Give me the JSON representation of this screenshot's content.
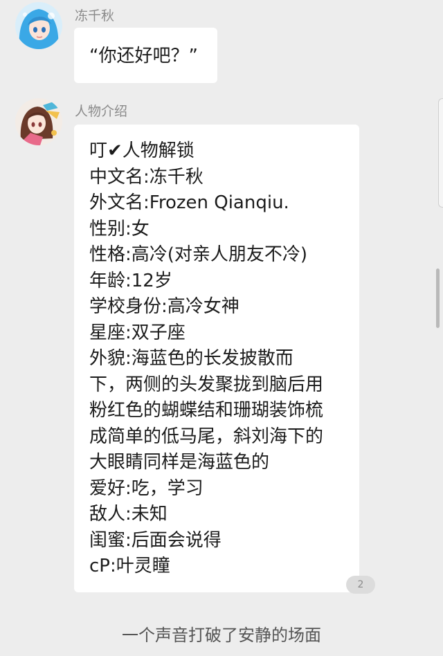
{
  "messages": [
    {
      "sender": "冻千秋",
      "avatar": "anime-girl-blue-hair-avatar",
      "lines": [
        "“你还好吧？”"
      ]
    },
    {
      "sender": "人物介绍",
      "avatar": "anime-girl-brown-hair-avatar",
      "lines": [
        "叮✔人物解锁",
        "中文名:冻千秋",
        "外文名:Frozen Qianqiu.",
        "性别:女",
        "性格:高冷(对亲人朋友不冷)",
        "年龄:12岁",
        "学校身份:高冷女神",
        "星座:双子座",
        "外貌:海蓝色的长发披散而",
        "下，两侧的头发聚拢到脑后用",
        "粉红色的蝴蝶结和珊瑚装饰梳",
        "成简单的低马尾，斜刘海下的",
        "大眼睛同样是海蓝色的",
        "爱好:吃，学习",
        "敌人:未知",
        "闺蜜:后面会说得",
        "cP:叶灵瞳"
      ]
    }
  ],
  "badge": "2",
  "bottom_text": "一个声音打破了安静的场面",
  "colors": {
    "background": "#ededed",
    "bubble": "#ffffff",
    "name": "#8a8a8a",
    "avatar1_hair": "#3aa8e6",
    "avatar2_hair": "#6b3a2a"
  }
}
